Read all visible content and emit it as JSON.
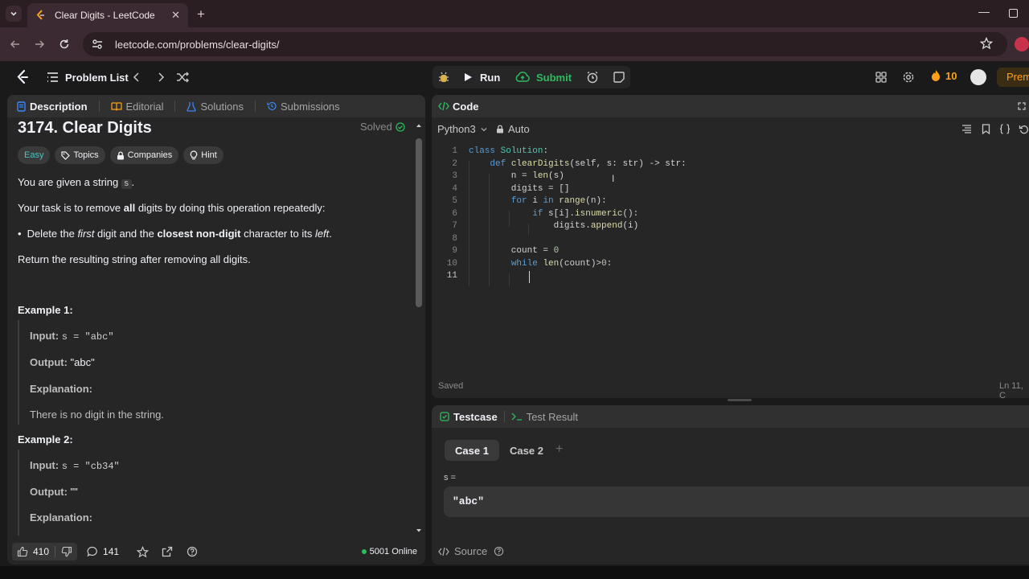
{
  "browser": {
    "tab_title": "Clear Digits - LeetCode",
    "url": "leetcode.com/problems/clear-digits/"
  },
  "nav": {
    "problem_list": "Problem List",
    "run": "Run",
    "submit": "Submit",
    "streak": "10",
    "premium": "Prem"
  },
  "left": {
    "tabs": [
      "Description",
      "Editorial",
      "Solutions",
      "Submissions"
    ],
    "title": "3174. Clear Digits",
    "status": "Solved",
    "tags": [
      "Easy",
      "Topics",
      "Companies",
      "Hint"
    ],
    "p1_pre": "You are given a string ",
    "p1_code": "s",
    "p1_post": ".",
    "p2_pre": "Your task is to remove ",
    "p2_bold": "all",
    "p2_post": " digits by doing this operation repeatedly:",
    "bullet_a": "Delete the ",
    "bullet_b": "first",
    "bullet_c": " digit and the ",
    "bullet_d": "closest non-digit",
    "bullet_e": " character to its ",
    "bullet_f": "left",
    "bullet_g": ".",
    "p3": "Return the resulting string after removing all digits.",
    "ex1_title": "Example 1:",
    "ex1_input_label": "Input:",
    "ex1_input": "s = \"abc\"",
    "ex1_output_label": "Output:",
    "ex1_output": "\"abc\"",
    "ex1_expl_label": "Explanation:",
    "ex1_expl": "There is no digit in the string.",
    "ex2_title": "Example 2:",
    "ex2_input_label": "Input:",
    "ex2_input": "s = \"cb34\"",
    "ex2_output_label": "Output:",
    "ex2_output": "\"\"",
    "ex2_expl_label": "Explanation:",
    "likes": "410",
    "comments": "141",
    "online": "5001 Online"
  },
  "code": {
    "header": "Code",
    "language": "Python3",
    "mode": "Auto",
    "lines": [
      {
        "n": "1",
        "text": "class Solution:"
      },
      {
        "n": "2",
        "text": "    def clearDigits(self, s: str) -> str:"
      },
      {
        "n": "3",
        "text": "        n = len(s)"
      },
      {
        "n": "4",
        "text": "        digits = []"
      },
      {
        "n": "5",
        "text": "        for i in range(n):"
      },
      {
        "n": "6",
        "text": "            if s[i].isnumeric():"
      },
      {
        "n": "7",
        "text": "                digits.append(i)"
      },
      {
        "n": "8",
        "text": ""
      },
      {
        "n": "9",
        "text": "        count = 0"
      },
      {
        "n": "10",
        "text": "        while len(count)>0:"
      },
      {
        "n": "11",
        "text": "            "
      }
    ],
    "saved": "Saved",
    "cursor_pos": "Ln 11, C"
  },
  "testcase": {
    "tab1": "Testcase",
    "tab2": "Test Result",
    "case1": "Case 1",
    "case2": "Case 2",
    "var_name": "s =",
    "var_value": "\"abc\"",
    "source": "Source"
  },
  "colors": {
    "accent": "#ffa116",
    "green": "#2cbb5d",
    "easy": "#46c6c2",
    "panel": "#262626",
    "background": "#1a1a1a"
  }
}
